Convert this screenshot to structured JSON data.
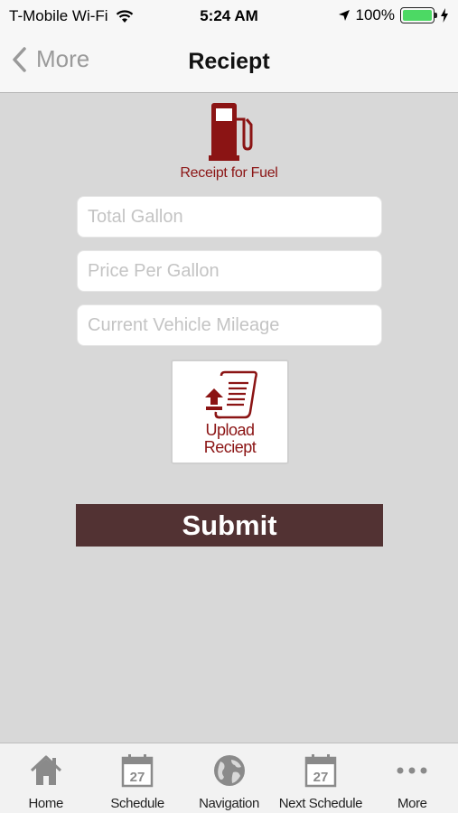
{
  "status_bar": {
    "carrier": "T-Mobile Wi-Fi",
    "time": "5:24 AM",
    "battery": "100%",
    "battery_level": 1.0
  },
  "nav": {
    "back_label": "More",
    "title": "Reciept"
  },
  "form": {
    "caption": "Receipt for Fuel",
    "fields": [
      {
        "placeholder": "Total Gallon",
        "value": ""
      },
      {
        "placeholder": "Price Per Gallon",
        "value": ""
      },
      {
        "placeholder": "Current Vehicle Mileage",
        "value": ""
      }
    ],
    "upload_label_line1": "Upload",
    "upload_label_line2": "Reciept",
    "submit_label": "Submit"
  },
  "tabs": [
    {
      "label": "Home",
      "icon": "home-icon"
    },
    {
      "label": "Schedule",
      "icon": "calendar-icon",
      "icon_text": "27"
    },
    {
      "label": "Navigation",
      "icon": "globe-icon"
    },
    {
      "label": "Next Schedule",
      "icon": "calendar-icon",
      "icon_text": "27"
    },
    {
      "label": "More",
      "icon": "more-dots-icon"
    }
  ],
  "colors": {
    "accent": "#8b1414",
    "submit_bg": "#523233",
    "background": "#d8d8d8",
    "battery": "#4cd964"
  }
}
